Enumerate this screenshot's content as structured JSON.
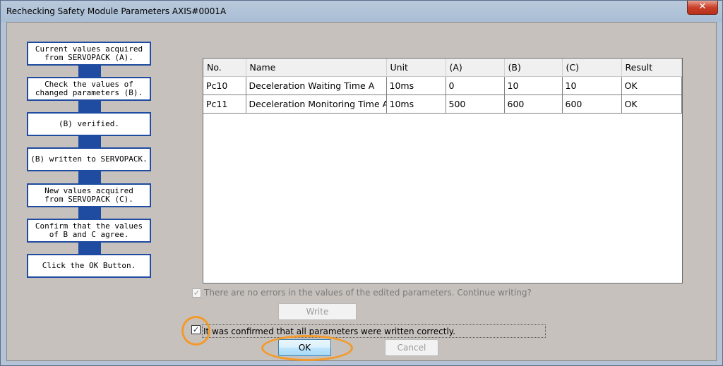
{
  "window": {
    "title": "Rechecking Safety Module Parameters AXIS#0001A",
    "close_glyph": "✕"
  },
  "flow": {
    "steps": [
      "Current values acquired\nfrom SERVOPACK (A).",
      "Check the values of\nchanged parameters (B).",
      "(B) verified.",
      "(B) written to SERVOPACK.",
      "New values acquired\nfrom SERVOPACK (C).",
      "Confirm that the values\nof B and C agree.",
      "Click the OK Button."
    ]
  },
  "table": {
    "columns": [
      "No.",
      "Name",
      "Unit",
      "(A)",
      "(B)",
      "(C)",
      "Result"
    ],
    "rows": [
      [
        "Pc10",
        "Deceleration Waiting Time A",
        "10ms",
        "0",
        "10",
        "10",
        "OK"
      ],
      [
        "Pc11",
        "Deceleration Monitoring Time A",
        "10ms",
        "500",
        "600",
        "600",
        "OK"
      ]
    ]
  },
  "no_errors_check": {
    "label": "There are no errors in the values of the edited parameters. Continue writing?",
    "checked_glyph": "✓"
  },
  "write_button": {
    "label": "Write"
  },
  "confirm_check": {
    "label": "It was confirmed that all parameters were written correctly.",
    "checked_glyph": "✓"
  },
  "ok_button": {
    "label": "OK"
  },
  "cancel_button": {
    "label": "Cancel"
  },
  "colors": {
    "flow_blue": "#1f4ba0",
    "highlight_orange": "#f39a2a"
  }
}
